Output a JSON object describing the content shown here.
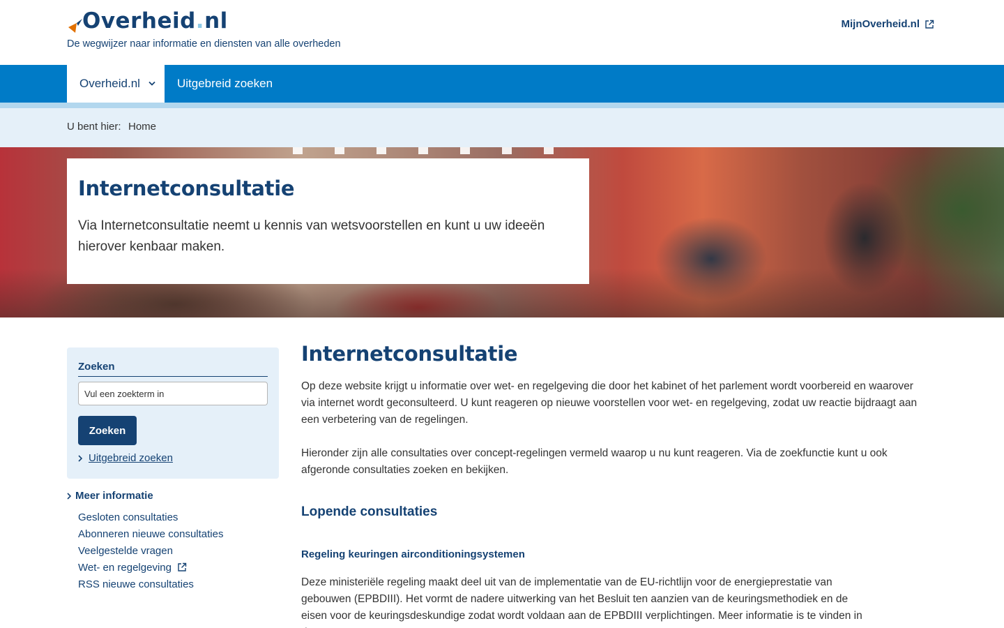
{
  "header": {
    "logo_text": "Overheid",
    "logo_dot": ".",
    "logo_tld": "nl",
    "tagline": "De wegwijzer naar informatie en diensten van alle overheden",
    "mijn_link": "MijnOverheid.nl"
  },
  "nav": {
    "active_label": "Overheid.nl",
    "items": [
      "Uitgebreid zoeken"
    ]
  },
  "breadcrumb": {
    "label": "U bent hier:",
    "home": "Home"
  },
  "hero": {
    "title": "Internetconsultatie",
    "text": "Via Internetconsultatie neemt u kennis van wetsvoorstellen en kunt u uw ideeën hierover kenbaar maken."
  },
  "search": {
    "label": "Zoeken",
    "placeholder": "Vul een zoekterm in",
    "button": "Zoeken",
    "advanced": "Uitgebreid zoeken"
  },
  "sidebar": {
    "meer_title": "Meer informatie",
    "links": [
      "Gesloten consultaties",
      "Abonneren nieuwe consultaties",
      "Veelgestelde vragen",
      "Wet- en regelgeving",
      "RSS nieuwe consultaties"
    ]
  },
  "main": {
    "title": "Internetconsultatie",
    "p1": "Op deze website krijgt u informatie over wet- en regelgeving die door het kabinet of het parlement wordt voorbereid en waarover via internet wordt geconsulteerd. U kunt reageren op nieuwe voorstellen voor wet- en regelgeving, zodat uw reactie bijdraagt aan een verbetering van de regelingen.",
    "p2": "Hieronder zijn alle consultaties over concept-regelingen vermeld waarop u nu kunt reageren. Via de zoekfunctie kunt u ook afgeronde consultaties zoeken en bekijken.",
    "section_title": "Lopende consultaties",
    "item_title": "Regeling keuringen airconditioningsystemen",
    "item_text": "Deze ministeriële regeling maakt deel uit van de implementatie van de EU-richtlijn voor de energieprestatie van gebouwen (EPBDIII). Het vormt de nadere uitwerking van het Besluit ten aanzien van de keuringsmethodiek en de eisen voor de keuringsdeskundige zodat wordt voldaan aan de EPBDIII verplichtingen. Meer informatie is te vinden in de nota van"
  },
  "colors": {
    "brand_dark": "#154273",
    "nav_blue": "#007bc7",
    "light_blue_bg": "#e5f0f9",
    "accent_orange": "#e17000"
  },
  "icons": {
    "logo": "overheid-logo-icon",
    "external": "external-link-icon",
    "dropdown": "chevron-down-icon",
    "bullet": "chevron-right-icon"
  }
}
